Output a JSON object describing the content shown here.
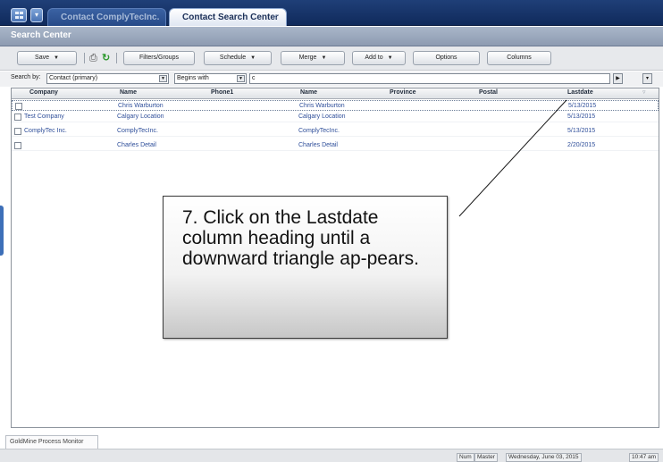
{
  "tabs": [
    {
      "label": "Contact ComplyTecInc."
    },
    {
      "label": "Contact Search Center",
      "close": "×"
    }
  ],
  "title": "Search Center",
  "toolbar": {
    "save": "Save",
    "filters": "Filters/Groups",
    "schedule": "Schedule",
    "merge": "Merge",
    "addto": "Add to",
    "options": "Options",
    "columns": "Columns",
    "dropdown_glyph": "▼"
  },
  "search": {
    "label": "Search by:",
    "field": "Contact (primary)",
    "operator": "Begins with",
    "value": "c"
  },
  "grid": {
    "columns": [
      "Company",
      "Name",
      "Phone1",
      "Name",
      "Province",
      "Postal",
      "Lastdate"
    ],
    "rows": [
      {
        "company": "",
        "name": "Chris Warburton",
        "phone1": "",
        "name2": "Chris Warburton",
        "province": "",
        "postal": "",
        "lastdate": "5/13/2015"
      },
      {
        "company": "Test Company",
        "name": "Calgary Location",
        "phone1": "",
        "name2": "Calgary Location",
        "province": "",
        "postal": "",
        "lastdate": "5/13/2015"
      },
      {
        "company": "ComplyTec Inc.",
        "name": "ComplyTecInc.",
        "phone1": "",
        "name2": "ComplyTecInc.",
        "province": "",
        "postal": "",
        "lastdate": "5/13/2015"
      },
      {
        "company": "",
        "name": "Charles Detail",
        "phone1": "",
        "name2": "Charles Detail",
        "province": "",
        "postal": "",
        "lastdate": "2/20/2015"
      }
    ]
  },
  "callout": {
    "text": "7. Click on the Lastdate column heading until a downward triangle ap-pears."
  },
  "bottom": {
    "process_monitor": "GoldMine Process Monitor",
    "status": [
      "Num",
      "Master",
      "Wednesday, June 03, 2015",
      "10:47 am"
    ]
  }
}
